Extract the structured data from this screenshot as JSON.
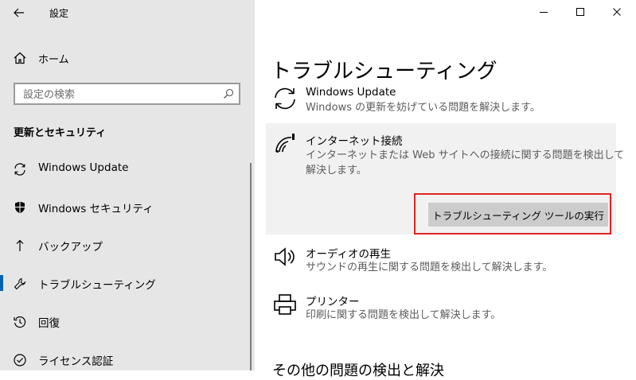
{
  "window": {
    "title": "設定",
    "controls": [
      "minimize",
      "maximize",
      "close"
    ]
  },
  "sidebar": {
    "home_label": "ホーム",
    "search": {
      "placeholder": "設定の検索"
    },
    "section_title": "更新とセキュリティ",
    "items": [
      {
        "label": "Windows Update",
        "icon": "sync-icon"
      },
      {
        "label": "Windows セキュリティ",
        "icon": "shield-icon"
      },
      {
        "label": "バックアップ",
        "icon": "backup-arrow-icon"
      },
      {
        "label": "トラブルシューティング",
        "icon": "wrench-icon",
        "active": true
      },
      {
        "label": "回復",
        "icon": "recovery-icon"
      },
      {
        "label": "ライセンス認証",
        "icon": "activation-check-icon"
      }
    ]
  },
  "main": {
    "title": "トラブルシューティング",
    "troubleshooters": [
      {
        "title": "Windows Update",
        "description": "Windows の更新を妨げている問題を解決します。",
        "icon": "sync-icon"
      },
      {
        "title": "インターネット接続",
        "description_line1": "インターネットまたは Web サイトへの接続に関する問題を検出して",
        "description_line2": "解決します。",
        "icon": "wifi-icon",
        "selected": true
      },
      {
        "title": "オーディオの再生",
        "description": "サウンドの再生に関する問題を検出して解決します。",
        "icon": "speaker-icon"
      },
      {
        "title": "プリンター",
        "description": "印刷に関する問題を検出して解決します。",
        "icon": "printer-icon"
      }
    ],
    "run_button_label": "トラブルシューティング ツールの実行",
    "more_section_title": "その他の問題の検出と解決"
  },
  "colors": {
    "sidebar_bg": "#e6e6e6",
    "accent": "#0063b1",
    "highlight_border": "#e02424",
    "button_bg": "#cccccc"
  }
}
